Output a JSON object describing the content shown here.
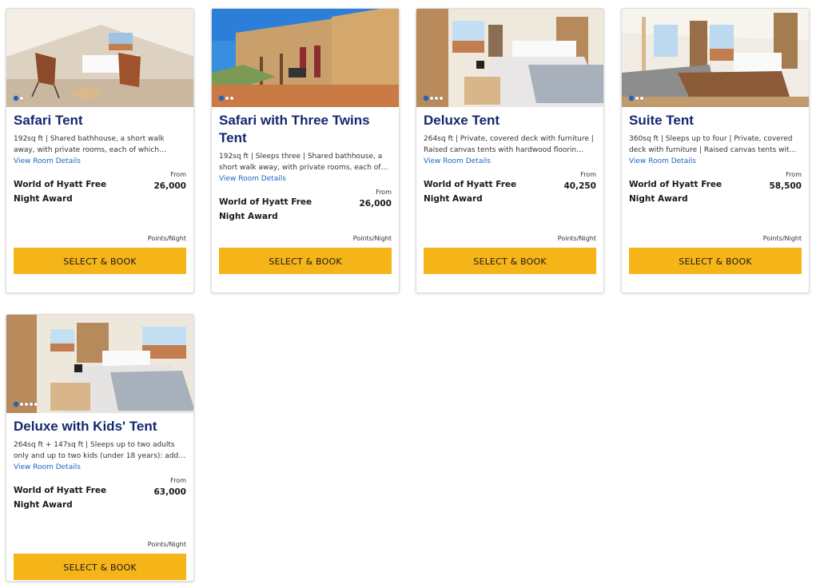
{
  "rooms": [
    {
      "title": "Safari Tent",
      "description": "192sq ft | Shared bathhouse, a short walk away, with private rooms, each of which…",
      "details_link": "View Room Details",
      "from_label": "From",
      "award_label": "World of Hyatt Free Night Award",
      "points": "26,000",
      "points_unit": "Points/Night",
      "button_label": "SELECT & BOOK",
      "photo_dots": 2,
      "photo_icon": "tent-interior-chairs-photo"
    },
    {
      "title": "Safari with Three Twins Tent",
      "description": "192sq ft | Sleeps three | Shared bathhouse, a short walk away, with private rooms, each of…",
      "details_link": "View Room Details",
      "from_label": "From",
      "award_label": "World of Hyatt Free Night Award",
      "points": "26,000",
      "points_unit": "Points/Night",
      "button_label": "SELECT & BOOK",
      "photo_dots": 3,
      "photo_icon": "bathhouse-exterior-photo"
    },
    {
      "title": "Deluxe Tent",
      "description": "264sq ft | Private, covered deck with furniture | Raised canvas tents with hardwood floorin…",
      "details_link": "View Room Details",
      "from_label": "From",
      "award_label": "World of Hyatt Free Night Award",
      "points": "40,250",
      "points_unit": "Points/Night",
      "button_label": "SELECT & BOOK",
      "photo_dots": 4,
      "photo_icon": "tent-bedroom-photo"
    },
    {
      "title": "Suite Tent",
      "description": "360sq ft | Sleeps up to four | Private, covered deck with furniture | Raised canvas tents wit…",
      "details_link": "View Room Details",
      "from_label": "From",
      "award_label": "World of Hyatt Free Night Award",
      "points": "58,500",
      "points_unit": "Points/Night",
      "button_label": "SELECT & BOOK",
      "photo_dots": 3,
      "photo_icon": "tent-suite-lounge-photo"
    },
    {
      "title": "Deluxe with Kids' Tent",
      "description": "264sq ft + 147sq ft | Sleeps up to two adults only and up to two kids (under 18 years): add…",
      "details_link": "View Room Details",
      "from_label": "From",
      "award_label": "World of Hyatt Free Night Award",
      "points": "63,000",
      "points_unit": "Points/Night",
      "button_label": "SELECT & BOOK",
      "photo_dots": 5,
      "photo_icon": "tent-bedroom-window-photo"
    }
  ],
  "colors": {
    "title": "#14286e",
    "link": "#1f63c5",
    "button": "#f5b418"
  }
}
